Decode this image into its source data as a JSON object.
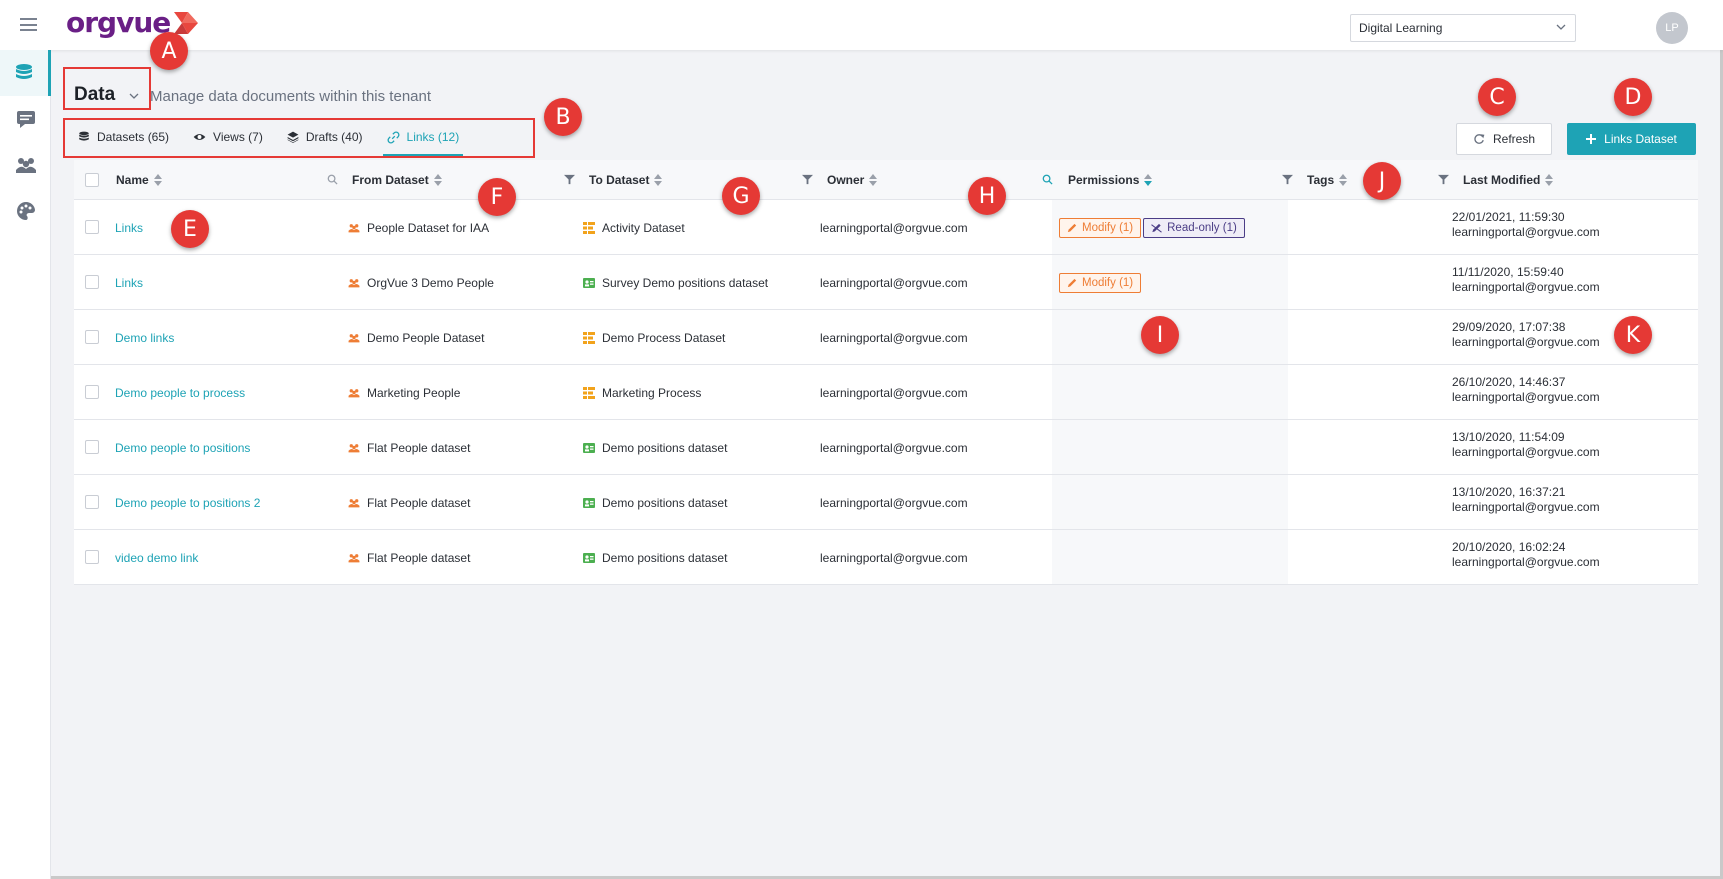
{
  "header": {
    "logo": "orgvue",
    "tenant": "Digital Learning",
    "user_initials": "LP"
  },
  "sidebar": {
    "items": [
      {
        "name": "data",
        "icon": "database-icon",
        "active": true
      },
      {
        "name": "messages",
        "icon": "message-icon",
        "active": false
      },
      {
        "name": "people",
        "icon": "people-icon",
        "active": false
      },
      {
        "name": "themes",
        "icon": "palette-icon",
        "active": false
      }
    ]
  },
  "page": {
    "title": "Data",
    "subtitle": "Manage data documents within this tenant"
  },
  "tabs": [
    {
      "label": "Datasets (65)",
      "icon": "database-icon",
      "active": false
    },
    {
      "label": "Views (7)",
      "icon": "eye-icon",
      "active": false
    },
    {
      "label": "Drafts (40)",
      "icon": "layers-icon",
      "active": false
    },
    {
      "label": "Links (12)",
      "icon": "link-icon",
      "active": true
    }
  ],
  "actions": {
    "refresh_label": "Refresh",
    "new_label": "Links Dataset"
  },
  "table": {
    "columns": {
      "name": "Name",
      "from": "From Dataset",
      "to": "To Dataset",
      "owner": "Owner",
      "permissions": "Permissions",
      "tags": "Tags",
      "modified": "Last Modified"
    },
    "rows": [
      {
        "name": "Links",
        "from": "People Dataset for IAA",
        "from_icon": "people-icon",
        "to": "Activity Dataset",
        "to_icon": "process-icon",
        "owner": "learningportal@orgvue.com",
        "modify": "Modify (1)",
        "readonly": "Read-only (1)",
        "date": "22/01/2021, 11:59:30",
        "by": "learningportal@orgvue.com"
      },
      {
        "name": "Links",
        "from": "OrgVue 3 Demo People",
        "from_icon": "people-icon",
        "to": "Survey Demo positions dataset",
        "to_icon": "positions-icon",
        "owner": "learningportal@orgvue.com",
        "modify": "Modify (1)",
        "readonly": "",
        "date": "11/11/2020, 15:59:40",
        "by": "learningportal@orgvue.com"
      },
      {
        "name": "Demo links",
        "from": "Demo People Dataset",
        "from_icon": "people-icon",
        "to": "Demo Process Dataset",
        "to_icon": "process-icon",
        "owner": "learningportal@orgvue.com",
        "modify": "",
        "readonly": "",
        "date": "29/09/2020, 17:07:38",
        "by": "learningportal@orgvue.com"
      },
      {
        "name": "Demo people to process",
        "from": "Marketing People",
        "from_icon": "people-icon",
        "to": "Marketing Process",
        "to_icon": "process-icon",
        "owner": "learningportal@orgvue.com",
        "modify": "",
        "readonly": "",
        "date": "26/10/2020, 14:46:37",
        "by": "learningportal@orgvue.com"
      },
      {
        "name": "Demo people to positions",
        "from": "Flat People dataset",
        "from_icon": "people-icon",
        "to": "Demo positions dataset",
        "to_icon": "positions-icon",
        "owner": "learningportal@orgvue.com",
        "modify": "",
        "readonly": "",
        "date": "13/10/2020, 11:54:09",
        "by": "learningportal@orgvue.com"
      },
      {
        "name": "Demo people to positions 2",
        "from": "Flat People dataset",
        "from_icon": "people-icon",
        "to": "Demo positions dataset",
        "to_icon": "positions-icon",
        "owner": "learningportal@orgvue.com",
        "modify": "",
        "readonly": "",
        "date": "13/10/2020, 16:37:21",
        "by": "learningportal@orgvue.com"
      },
      {
        "name": "video demo link",
        "from": "Flat People dataset",
        "from_icon": "people-icon",
        "to": "Demo positions dataset",
        "to_icon": "positions-icon",
        "owner": "learningportal@orgvue.com",
        "modify": "",
        "readonly": "",
        "date": "20/10/2020, 16:02:24",
        "by": "learningportal@orgvue.com"
      }
    ]
  },
  "annotations": [
    "A",
    "B",
    "C",
    "D",
    "E",
    "F",
    "G",
    "H",
    "I",
    "J",
    "K"
  ],
  "colors": {
    "accent": "#1ea3b5",
    "brand": "#6a1f86",
    "modify": "#ee7d35",
    "readonly": "#4b3d86",
    "marker": "#e53935",
    "people_icon": "#ee7d35",
    "process_icon": "#f2a31c",
    "positions_icon": "#4caf50"
  }
}
